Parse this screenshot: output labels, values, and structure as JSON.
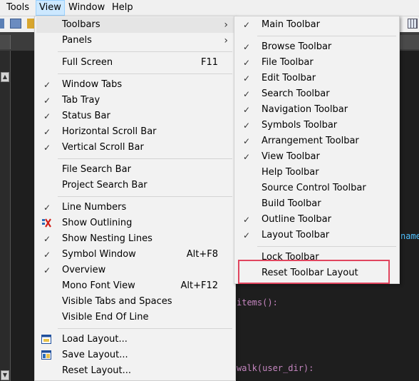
{
  "menubar": {
    "items": [
      "Tools",
      "View",
      "Window",
      "Help"
    ]
  },
  "editor": {
    "code_fragments": [
      "name",
      "items():",
      "walk(user_dir):"
    ],
    "colors": {
      "background": "#1e1e1e",
      "keyword": "#c586c0",
      "ident": "#4fc1ff"
    }
  },
  "view_menu": {
    "items": [
      {
        "label": "Toolbars",
        "submenu": true,
        "highlighted": true
      },
      {
        "label": "Panels",
        "submenu": true
      },
      {
        "label": "Full Screen",
        "shortcut": "F11"
      },
      {
        "label": "Window Tabs",
        "checked": true
      },
      {
        "label": "Tab Tray",
        "checked": true
      },
      {
        "label": "Status Bar",
        "checked": true
      },
      {
        "label": "Horizontal Scroll Bar",
        "checked": true
      },
      {
        "label": "Vertical Scroll Bar",
        "checked": true
      },
      {
        "label": "File Search Bar"
      },
      {
        "label": "Project Search Bar"
      },
      {
        "label": "Line Numbers",
        "checked": true
      },
      {
        "label": "Show Outlining",
        "icon": "outlining-icon"
      },
      {
        "label": "Show Nesting Lines",
        "checked": true
      },
      {
        "label": "Symbol Window",
        "checked": true,
        "shortcut": "Alt+F8"
      },
      {
        "label": "Overview",
        "checked": true
      },
      {
        "label": "Mono Font View",
        "shortcut": "Alt+F12"
      },
      {
        "label": "Visible Tabs and Spaces"
      },
      {
        "label": "Visible End Of Line"
      },
      {
        "label": "Load Layout...",
        "icon": "load-layout-icon"
      },
      {
        "label": "Save Layout...",
        "icon": "save-layout-icon"
      },
      {
        "label": "Reset Layout..."
      }
    ]
  },
  "toolbars_submenu": {
    "items": [
      {
        "label": "Main Toolbar",
        "checked": true
      },
      {
        "label": "Browse Toolbar",
        "checked": true
      },
      {
        "label": "File Toolbar",
        "checked": true
      },
      {
        "label": "Edit Toolbar",
        "checked": true
      },
      {
        "label": "Search Toolbar",
        "checked": true
      },
      {
        "label": "Navigation Toolbar",
        "checked": true
      },
      {
        "label": "Symbols Toolbar",
        "checked": true
      },
      {
        "label": "Arrangement Toolbar",
        "checked": true
      },
      {
        "label": "View Toolbar",
        "checked": true
      },
      {
        "label": "Help Toolbar"
      },
      {
        "label": "Source Control Toolbar"
      },
      {
        "label": "Build Toolbar"
      },
      {
        "label": "Outline Toolbar",
        "checked": true
      },
      {
        "label": "Layout Toolbar",
        "checked": true
      },
      {
        "label": "Lock Toolbar"
      },
      {
        "label": "Reset Toolbar Layout",
        "annotated": true
      }
    ]
  },
  "glyphs": {
    "check": "✓",
    "submenu_arrow": "›"
  },
  "annotation_color": "#e0455e"
}
